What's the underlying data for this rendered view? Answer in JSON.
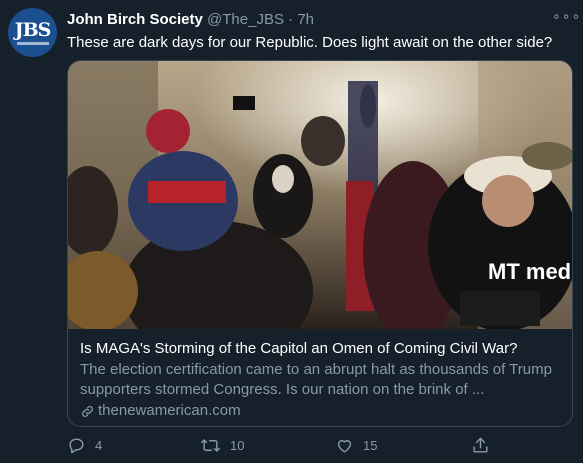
{
  "tweet": {
    "avatar_text": "JBS",
    "name": "John Birch Society",
    "handle": "@The_JBS",
    "separator": "·",
    "time": "7h",
    "more_label": "∘∘∘",
    "text": "These are dark days for our Republic. Does light await on the other side?"
  },
  "card": {
    "image_sign": "MT media",
    "title": "Is MAGA's Storming of the Capitol an Omen of Coming Civil War?",
    "description": "The election certification came to an abrupt halt as thousands of Trump supporters stormed Congress. Is our nation on the brink of ...",
    "link": "thenewamerican.com"
  },
  "actions": {
    "reply_icon": "reply-icon",
    "replies": "4",
    "retweet_icon": "retweet-icon",
    "retweets": "10",
    "like_icon": "heart-icon",
    "likes": "15",
    "share_icon": "share-icon"
  },
  "colors": {
    "background": "#15202b",
    "secondary_text": "#8899a6",
    "border": "#38444d",
    "avatar": "#1b4f8f"
  }
}
